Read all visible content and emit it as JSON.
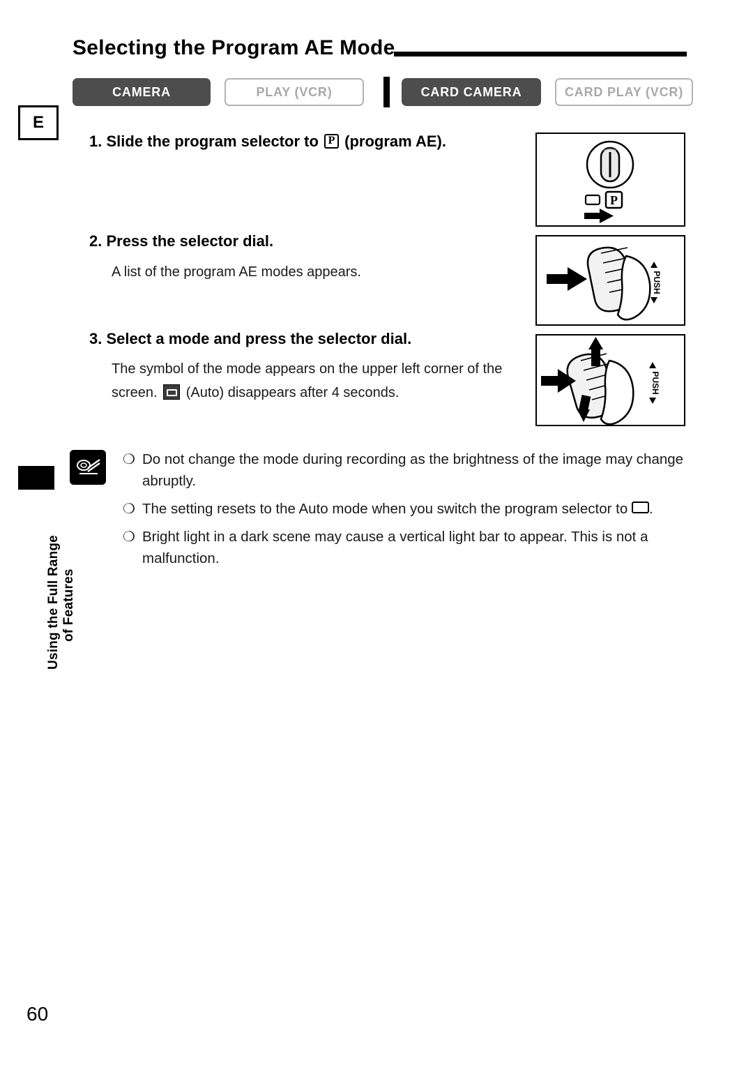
{
  "page": {
    "title": "Selecting the Program AE Mode",
    "number": "60",
    "language_tab": "E"
  },
  "tabs": [
    {
      "label": "CAMERA",
      "state": "on"
    },
    {
      "label": "PLAY (VCR)",
      "state": "off"
    },
    {
      "label": "CARD CAMERA",
      "state": "on"
    },
    {
      "label": "CARD PLAY (VCR)",
      "state": "off"
    }
  ],
  "steps": [
    {
      "heading_prefix": "1.",
      "heading_part1": "Slide the program selector to",
      "heading_icon": "program-ae-p-icon",
      "heading_part2": "(program AE).",
      "body": ""
    },
    {
      "heading": "2. Press the selector dial.",
      "body": "A list of the program AE modes appears."
    },
    {
      "heading": "3. Select a mode and press the selector dial.",
      "body_line1": "The symbol of the mode appears on the upper left corner of the",
      "body_line2_pre": "screen.",
      "body_icon": "auto-mode-icon",
      "body_line2_post": "(Auto) disappears after 4 seconds."
    }
  ],
  "illustrations": [
    {
      "name": "program-selector-slide-illustration",
      "caption": "P"
    },
    {
      "name": "selector-dial-press-illustration",
      "caption": "PUSH"
    },
    {
      "name": "selector-dial-turn-press-illustration",
      "caption": "PUSH"
    }
  ],
  "notes": {
    "icon": "notes-pencil-icon",
    "items": [
      {
        "bullet": "❍",
        "text": "Do not change the mode during recording as the brightness of the image may change abruptly."
      },
      {
        "bullet": "❍",
        "text_pre": "The setting resets to the Auto mode when you switch the program selector to",
        "icon": "blank-rectangle-icon",
        "text_post": "."
      },
      {
        "bullet": "❍",
        "text": "Bright light in a dark scene may cause a vertical light bar to appear. This is not a malfunction."
      }
    ]
  },
  "side_label": {
    "line1": "Using the Full Range",
    "line2": "of Features"
  }
}
